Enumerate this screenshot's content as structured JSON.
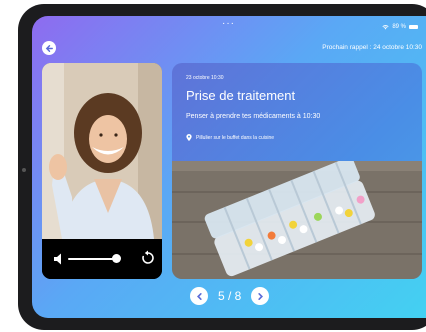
{
  "status": {
    "battery": "89 %"
  },
  "header": {
    "reminder": "Prochain rappel : 24 octobre 10:30"
  },
  "card": {
    "date": "23 octobre  10:30",
    "title": "Prise de traitement",
    "subtitle": "Penser à prendre tes médicaments à 10:30",
    "location": "Pillulier sur le buffet dans la cuisine"
  },
  "pager": {
    "count": "5 / 8"
  },
  "colors": {
    "accent": "#5a6bd8",
    "gradient_start": "#8e6bf0",
    "gradient_end": "#43d1f2"
  }
}
